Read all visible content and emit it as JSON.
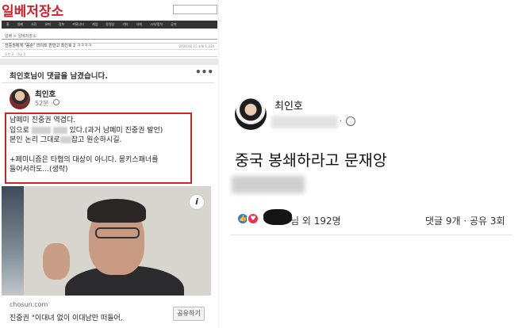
{
  "left": {
    "site_logo": "일베저장소",
    "site_logo_small": "일간",
    "nav_items": [
      "홈",
      "일베",
      "사진",
      "유머",
      "정보",
      "커뮤니티",
      "게임",
      "동영상",
      "기타",
      "사회",
      "시사/정치",
      "공지"
    ],
    "breadcrumb": "일베 > 일베저장소",
    "post_title": "진중권에게 \"꼼순\" 라이트 반반고 최인호 2 ㅋㅋㅋㅋ",
    "post_meta": "2020.02.15 조회 1,234",
    "meta_row": "추천 0 · 댓글 0",
    "commented_notice": "최인호님이 댓글을 남겼습니다.",
    "more_dots": "•••",
    "poster_name": "최인호",
    "poster_time": "52분 ·",
    "post_lines": [
      "남페미 진중권 역겹다.",
      "입으로",
      "있다.(과거 남페미 진중권 발언)",
      "본인 논리 그대로",
      "잡고 원순하시길.",
      "+페미니즘은 타협의 대상이 아니다. 몽키스패너를",
      "들어서라도...(생략)"
    ],
    "info_icon": "i",
    "link_domain": "chosun.com",
    "link_title": "진중권 \"이대녀 없이 이대남만 떠들어,",
    "share_label": "공유하기"
  },
  "right": {
    "poster_name": "최인호",
    "dot": "·",
    "post_text": "중국 봉쇄하라고 문재앙",
    "reactors": "님 외 192명",
    "stats": "댓글 9개 · 공유 3회",
    "like_icon": "👍",
    "love_icon": "♥"
  },
  "colors": {
    "highlight_border": "#d32626",
    "like": "#2c7be5",
    "love": "#e8344f",
    "logo": "#d8202a"
  }
}
